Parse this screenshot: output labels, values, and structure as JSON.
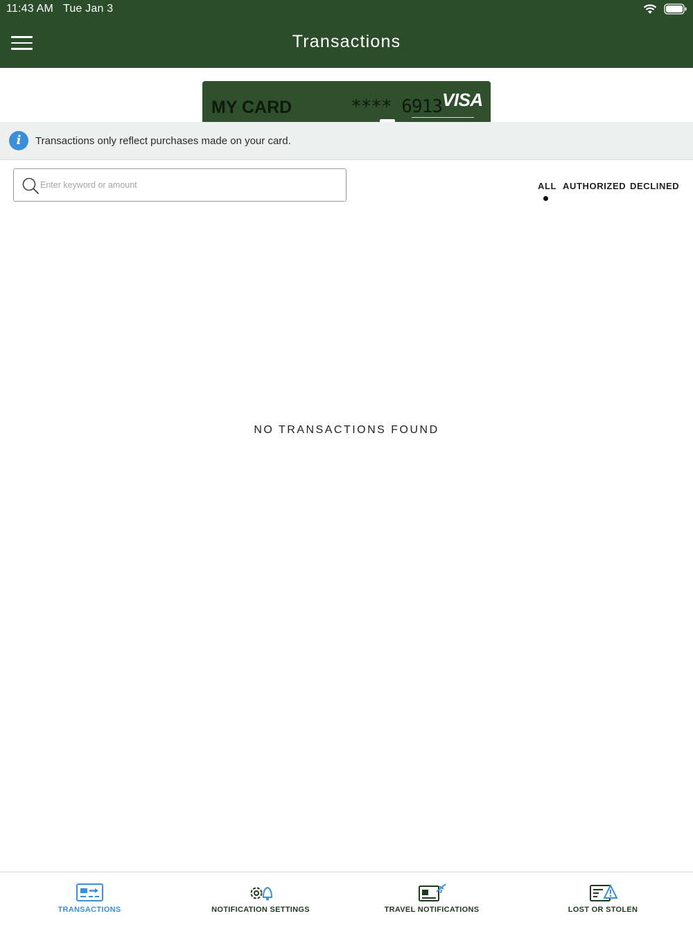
{
  "status_bar": {
    "time": "11:43 AM",
    "date": "Tue Jan 3",
    "icons": [
      "wifi-icon",
      "battery-icon"
    ]
  },
  "header": {
    "title": "Transactions",
    "menu_icon": "hamburger-menu-icon",
    "background_color": "#2b4d2a"
  },
  "card": {
    "name": "MY CARD",
    "masked_number": "**** 6913",
    "brand": "VISA",
    "color": "#2f4f2d"
  },
  "info_banner": {
    "icon": "info-icon",
    "text": "Transactions only reflect purchases made on your card."
  },
  "search": {
    "placeholder": "Enter keyword or amount",
    "value": ""
  },
  "filters": {
    "tabs": [
      {
        "label": "ALL",
        "selected": true
      },
      {
        "label": "AUTHORIZED",
        "selected": false
      },
      {
        "label": "DECLINED",
        "selected": false
      }
    ]
  },
  "main": {
    "empty_message": "NO TRANSACTIONS FOUND"
  },
  "bottom_nav": {
    "active_color": "#3b8fd9",
    "items": [
      {
        "label": "TRANSACTIONS",
        "icon": "transactions-card-icon",
        "active": true
      },
      {
        "label": "NOTIFICATION SETTINGS",
        "icon": "gear-bell-icon",
        "active": false
      },
      {
        "label": "TRAVEL NOTIFICATIONS",
        "icon": "card-airplane-icon",
        "active": false
      },
      {
        "label": "LOST OR STOLEN",
        "icon": "card-warning-icon",
        "active": false
      }
    ]
  }
}
